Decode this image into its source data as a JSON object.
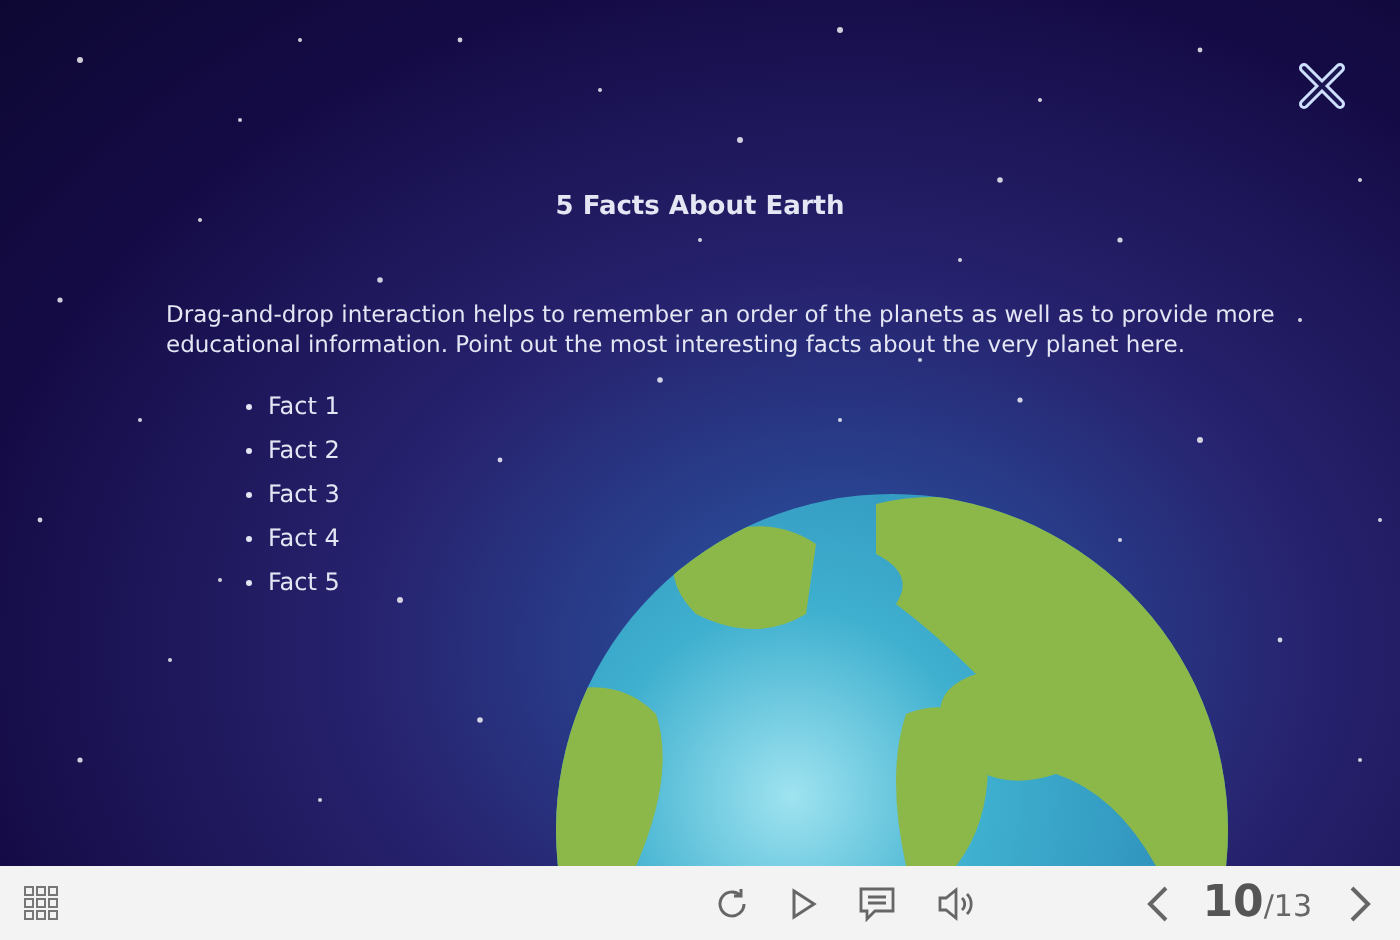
{
  "slide": {
    "title": "5 Facts About Earth",
    "description": "Drag-and-drop interaction helps to remember an order of the planets as well as to provide more educational information. Point out the most interesting facts about the very planet here.",
    "facts": [
      "Fact 1",
      "Fact 2",
      "Fact 3",
      "Fact 4",
      "Fact 5"
    ]
  },
  "player_bar": {
    "current": "10",
    "total": "/13"
  }
}
